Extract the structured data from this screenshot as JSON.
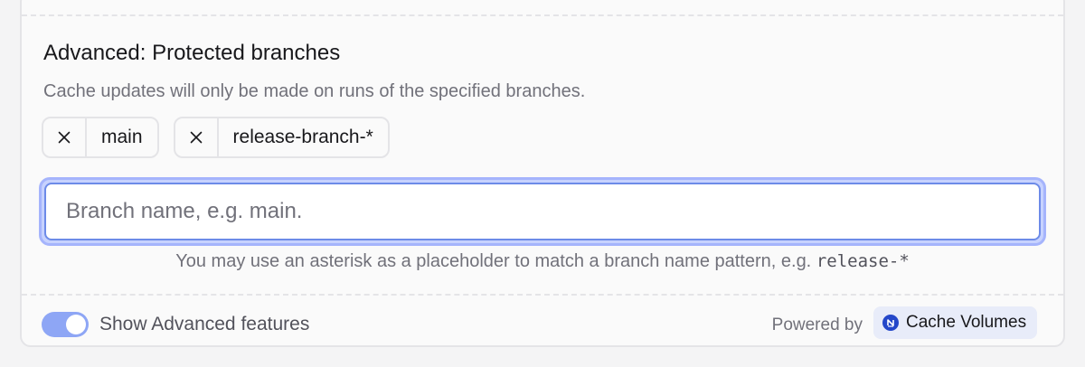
{
  "section": {
    "title": "Advanced: Protected branches",
    "description": "Cache updates will only be made on runs of the specified branches."
  },
  "branches": [
    {
      "label": "main"
    },
    {
      "label": "release-branch-*"
    }
  ],
  "input": {
    "placeholder": "Branch name, e.g. main.",
    "value": ""
  },
  "hint": {
    "text": "You may use an asterisk as a placeholder to match a branch name pattern, e.g. ",
    "code": "release-*"
  },
  "footer": {
    "toggle_label": "Show Advanced features",
    "toggle_on": true,
    "powered_by": "Powered by",
    "product": "Cache Volumes"
  },
  "icons": {
    "remove": "close-icon",
    "product_logo": "cache-volumes-logo-icon"
  },
  "colors": {
    "accent": "#8ea6f5",
    "focus_ring": "#a5b4fc",
    "logo": "#2447c9"
  }
}
